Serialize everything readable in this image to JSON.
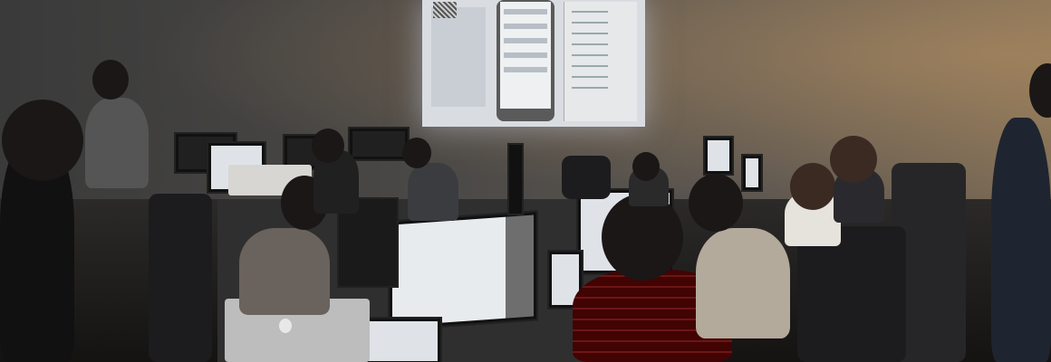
{
  "scene": {
    "description_kind": "photo",
    "colors": {
      "wall_dark": "#3a3a3a",
      "wall_warm": "#7a6a55",
      "projection": "#d9dde2",
      "screen": "#dfe3e8",
      "plaid": "#8a1c1c"
    },
    "icons": [
      "apple-logo-icon"
    ]
  }
}
